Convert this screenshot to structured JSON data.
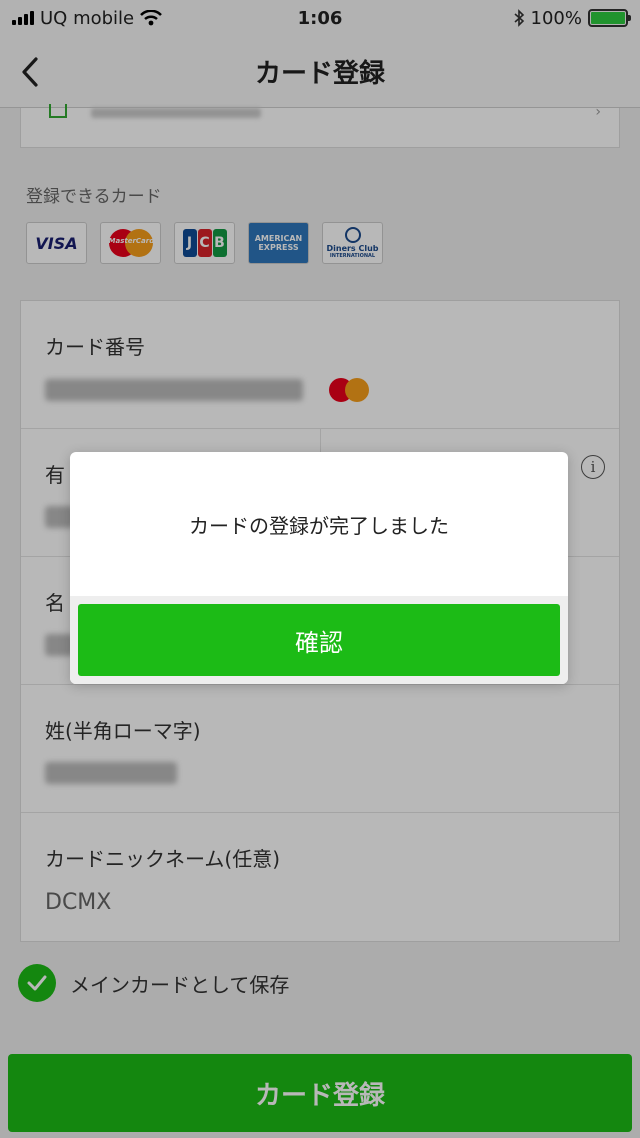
{
  "status_bar": {
    "carrier": "UQ mobile",
    "time": "1:06",
    "battery_percent": "100%",
    "battery_level": 1.0
  },
  "nav": {
    "title": "カード登録"
  },
  "supported_cards": {
    "label": "登録できるカード",
    "brands": {
      "visa": "VISA",
      "mastercard": "MasterCard",
      "jcb_j": "J",
      "jcb_c": "C",
      "jcb_b": "B",
      "amex_1": "AMERICAN",
      "amex_2": "EXPRESS",
      "diners_1": "Diners Club",
      "diners_2": "INTERNATIONAL"
    }
  },
  "form": {
    "card_number_label": "カード番号",
    "expiry_label": "有",
    "first_name_label": "名",
    "last_name_label": "姓(半角ローマ字)",
    "nickname_label": "カードニックネーム(任意)",
    "nickname_value": "DCMX"
  },
  "main_card": {
    "label": "メインカードとして保存",
    "checked": true
  },
  "register_button": {
    "label": "カード登録"
  },
  "dialog": {
    "message": "カードの登録が完了しました",
    "confirm_label": "確認"
  },
  "colors": {
    "accent_green": "#1cbb16",
    "overlay": "rgba(0,0,0,0.28)"
  }
}
